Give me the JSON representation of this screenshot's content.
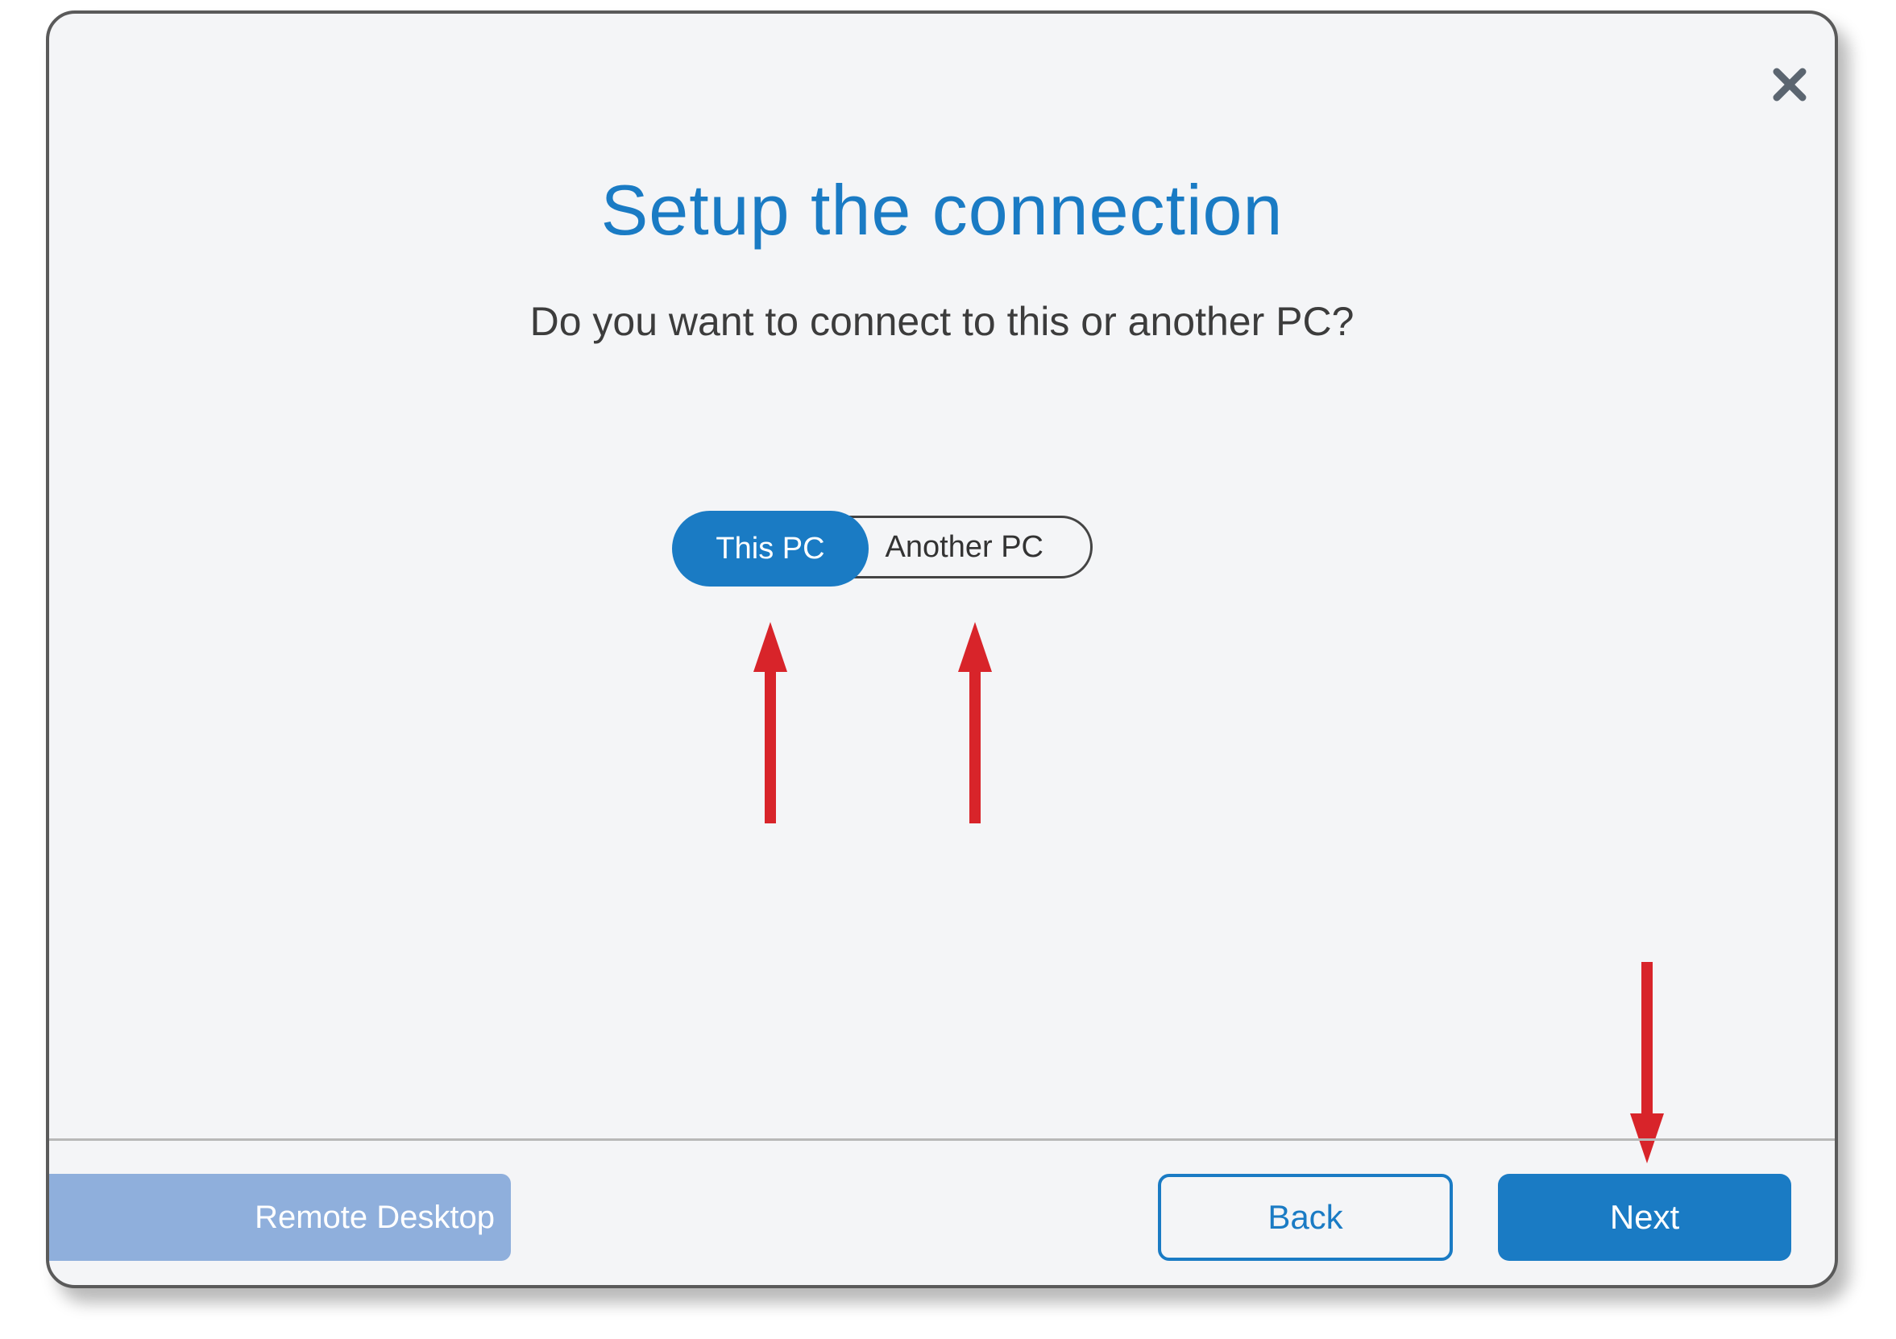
{
  "dialog": {
    "title": "Setup the connection",
    "subtitle": "Do you want to connect to this or another PC?",
    "close_icon": "close-icon"
  },
  "toggle": {
    "options": [
      "This PC",
      "Another PC"
    ],
    "selected": "This PC"
  },
  "footer": {
    "brand_label": "Remote Desktop",
    "back_label": "Back",
    "next_label": "Next"
  },
  "annotations": {
    "arrow_color": "#d8242a",
    "arrows": [
      "arrow-up-icon",
      "arrow-up-icon",
      "arrow-down-icon"
    ]
  },
  "colors": {
    "accent": "#1a7bc4",
    "brand_bg": "#8fafdc",
    "dialog_bg": "#f4f5f7"
  }
}
